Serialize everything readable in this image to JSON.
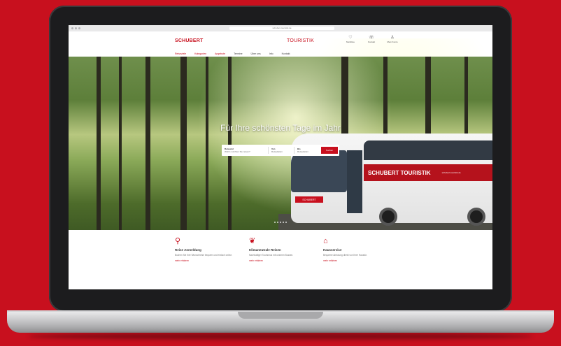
{
  "browser": {
    "url": "schubert-touristik.de"
  },
  "site": {
    "logo_brand": "SCHUBERT",
    "logo_suffix": "TOURISTIK",
    "header_icons": [
      {
        "icon": "heart-icon",
        "label": "Merkliste"
      },
      {
        "icon": "phone-icon",
        "label": "Kontakt"
      },
      {
        "icon": "user-icon",
        "label": "Mein Konto"
      }
    ],
    "nav": [
      {
        "label": "Reiseziele",
        "active": true
      },
      {
        "label": "Kategorien",
        "active": true
      },
      {
        "label": "Angebote",
        "active": true
      },
      {
        "label": "Termine",
        "active": false
      },
      {
        "label": "Über uns",
        "active": false
      },
      {
        "label": "Info",
        "active": false
      },
      {
        "label": "Kontakt",
        "active": false
      }
    ]
  },
  "hero": {
    "heading": "Für Ihre schönsten Tage im Jahr",
    "search": {
      "field1_label": "Reiseziel",
      "field1_value": "Wohin möchten Sie reisen?",
      "field2_label": "Von",
      "field2_value": "Reisedatum",
      "field3_label": "Bis",
      "field3_value": "Reisedatum",
      "button": "Suchen"
    },
    "bus_brand": "SCHUBERT TOURISTIK",
    "bus_tagline": "schubert-touristik.de",
    "bus_badge": "SCHUBERT"
  },
  "features": [
    {
      "icon": "pin-icon",
      "title": "Reise Anmeldung",
      "desc": "Buchen Sie Ihre Wunschreise bequem und einfach online.",
      "link": "mehr erfahren"
    },
    {
      "icon": "leaf-icon",
      "title": "Klimaneutrale Reisen",
      "desc": "Nachhaltiger Tourismus mit unseren Bussen.",
      "link": "mehr erfahren"
    },
    {
      "icon": "house-icon",
      "title": "Hausservice",
      "desc": "Bequeme Abholung direkt von Ihrer Haustür.",
      "link": "mehr erfahren"
    }
  ]
}
